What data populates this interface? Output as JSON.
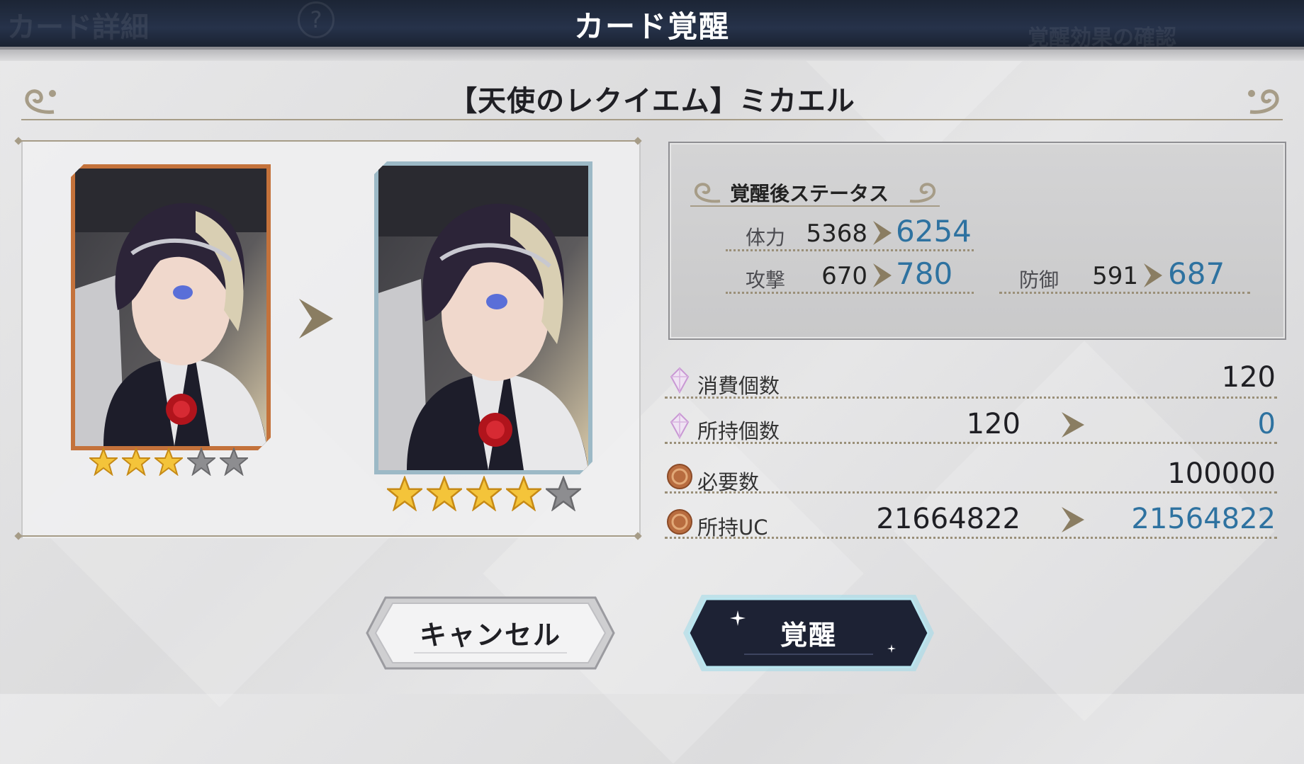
{
  "header": {
    "title": "カード覚醒",
    "bg_left_text": "カード詳細",
    "bg_help_glyph": "?",
    "bg_right_text": "覚醒効果の確認"
  },
  "card": {
    "name": "【天使のレクイエム】ミカエル",
    "before_stars": 3,
    "after_stars": 4,
    "max_stars": 5
  },
  "status": {
    "heading": "覚醒後ステータス",
    "hp": {
      "label": "体力",
      "old": "5368",
      "new": "6254"
    },
    "atk": {
      "label": "攻撃",
      "old": "670",
      "new": "780"
    },
    "def": {
      "label": "防御",
      "old": "591",
      "new": "687"
    }
  },
  "resources": {
    "consume": {
      "label": "消費個数",
      "value": "120"
    },
    "owned": {
      "label": "所持個数",
      "old": "120",
      "new": "0"
    },
    "required": {
      "label": "必要数",
      "value": "100000"
    },
    "owned_uc": {
      "label": "所持UC",
      "old": "21664822",
      "new": "21564822"
    }
  },
  "buttons": {
    "cancel": "キャンセル",
    "awaken": "覚醒"
  },
  "colors": {
    "accent_blue": "#2e72a0",
    "gold": "#a69c87",
    "header_bg": "#1c2535",
    "card_before_frame": "#c4723b",
    "card_after_frame": "#9cb9c6"
  }
}
